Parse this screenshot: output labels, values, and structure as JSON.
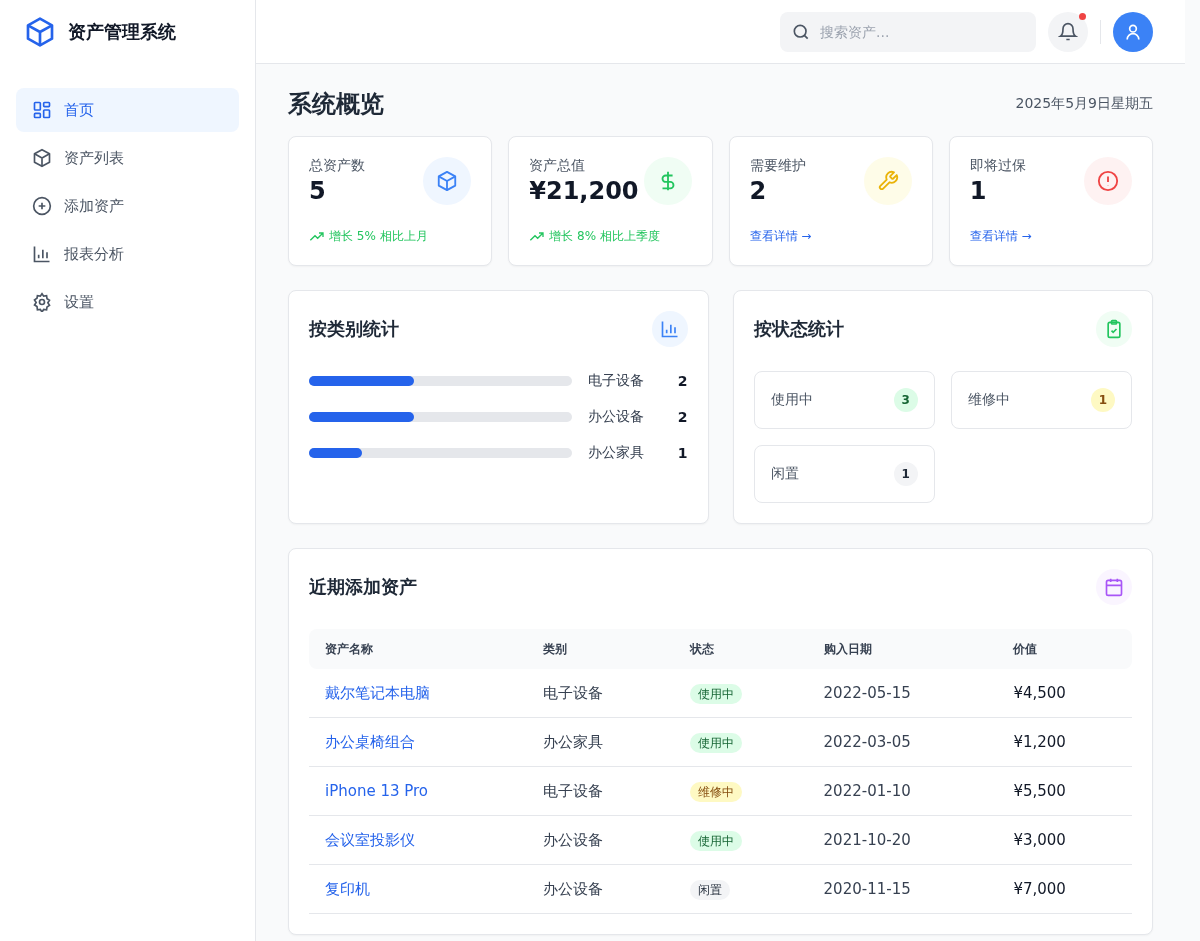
{
  "app": {
    "title": "资产管理系统"
  },
  "sidebar": {
    "items": [
      {
        "label": "首页",
        "selected": true
      },
      {
        "label": "资产列表",
        "selected": false
      },
      {
        "label": "添加资产",
        "selected": false
      },
      {
        "label": "报表分析",
        "selected": false
      },
      {
        "label": "设置",
        "selected": false
      }
    ]
  },
  "header": {
    "search": {
      "placeholder": "搜索资产..."
    },
    "notification_unread": true
  },
  "page": {
    "title": "系统概览",
    "date": "2025年5月9日星期五"
  },
  "stats": [
    {
      "label": "总资产数",
      "value": "5",
      "kind": "trend",
      "footer": "增长 5% 相比上月"
    },
    {
      "label": "资产总值",
      "value": "¥21,200",
      "kind": "trend",
      "footer": "增长 8% 相比上季度"
    },
    {
      "label": "需要维护",
      "value": "2",
      "kind": "link",
      "footer": "查看详情 →"
    },
    {
      "label": "即将过保",
      "value": "1",
      "kind": "link",
      "footer": "查看详情 →"
    }
  ],
  "by_category": {
    "title": "按类别统计",
    "items": [
      {
        "name": "电子设备",
        "count": "2",
        "level": 0.4
      },
      {
        "name": "办公设备",
        "count": "2",
        "level": 0.4
      },
      {
        "name": "办公家具",
        "count": "1",
        "level": 0.2
      }
    ]
  },
  "by_status": {
    "title": "按状态统计",
    "items": [
      {
        "name": "使用中",
        "count": "3",
        "kind": "in_use"
      },
      {
        "name": "维修中",
        "count": "1",
        "kind": "repair"
      },
      {
        "name": "闲置",
        "count": "1",
        "kind": "idle"
      }
    ]
  },
  "recent": {
    "title": "近期添加资产",
    "columns": [
      "资产名称",
      "类别",
      "状态",
      "购入日期",
      "价值"
    ],
    "rows": [
      {
        "name": "戴尔笔记本电脑",
        "category": "电子设备",
        "status": "使用中",
        "kind": "in_use",
        "date": "2022-05-15",
        "value": "¥4,500"
      },
      {
        "name": "办公桌椅组合",
        "category": "办公家具",
        "status": "使用中",
        "kind": "in_use",
        "date": "2022-03-05",
        "value": "¥1,200"
      },
      {
        "name": "iPhone 13 Pro",
        "category": "电子设备",
        "status": "维修中",
        "kind": "repair",
        "date": "2022-01-10",
        "value": "¥5,500"
      },
      {
        "name": "会议室投影仪",
        "category": "办公设备",
        "status": "使用中",
        "kind": "in_use",
        "date": "2021-10-20",
        "value": "¥3,000"
      },
      {
        "name": "复印机",
        "category": "办公设备",
        "status": "闲置",
        "kind": "idle",
        "date": "2020-11-15",
        "value": "¥7,000"
      }
    ]
  }
}
